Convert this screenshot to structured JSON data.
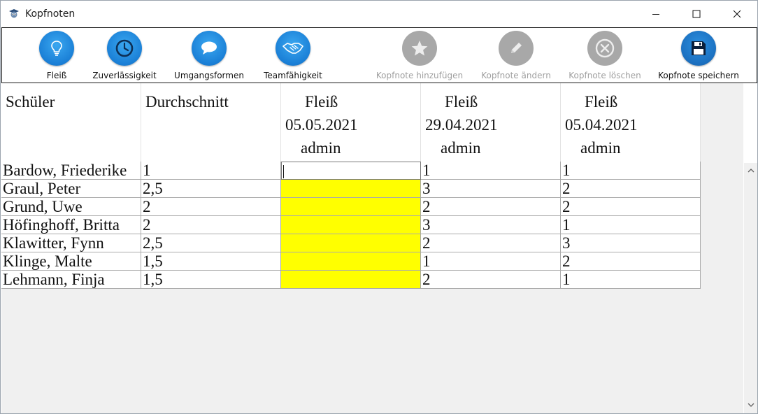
{
  "window": {
    "title": "Kopfnoten"
  },
  "toolbar": {
    "buttons": [
      {
        "label": "Fleiß",
        "icon": "lightbulb-icon",
        "enabled": true
      },
      {
        "label": "Zuverlässigkeit",
        "icon": "clock-icon",
        "enabled": true
      },
      {
        "label": "Umgangsformen",
        "icon": "speech-bubble-icon",
        "enabled": true
      },
      {
        "label": "Teamfähigkeit",
        "icon": "handshake-icon",
        "enabled": true
      },
      {
        "label": "Kopfnote hinzufügen",
        "icon": "star-icon",
        "enabled": false
      },
      {
        "label": "Kopfnote ändern",
        "icon": "pencil-icon",
        "enabled": false
      },
      {
        "label": "Kopfnote löschen",
        "icon": "delete-circle-icon",
        "enabled": false
      },
      {
        "label": "Kopfnote speichern",
        "icon": "floppy-disk-icon",
        "enabled": true
      }
    ]
  },
  "grid": {
    "columns": [
      {
        "lines": [
          "Schüler"
        ]
      },
      {
        "lines": [
          "Durchschnitt"
        ]
      },
      {
        "lines": [
          "Fleiß",
          "05.05.2021",
          "admin"
        ]
      },
      {
        "lines": [
          "Fleiß",
          "29.04.2021",
          "admin"
        ]
      },
      {
        "lines": [
          "Fleiß",
          "05.04.2021",
          "admin"
        ]
      }
    ],
    "rows": [
      [
        "Bardow, Friederike",
        "1",
        "",
        "1",
        "1"
      ],
      [
        "Graul, Peter",
        "2,5",
        "",
        "3",
        "2"
      ],
      [
        "Grund, Uwe",
        "2",
        "",
        "2",
        "2"
      ],
      [
        "Höfinghoff, Britta",
        "2",
        "",
        "3",
        "1"
      ],
      [
        "Klawitter, Fynn",
        "2,5",
        "",
        "2",
        "3"
      ],
      [
        "Klinge, Malte",
        "1,5",
        "",
        "1",
        "2"
      ],
      [
        "Lehmann, Finja",
        "1,5",
        "",
        "2",
        "1"
      ]
    ],
    "highlight_color": "#ffff00",
    "editing_cell": {
      "row": 0,
      "column": 2
    }
  },
  "colors": {
    "accent": "#1a7fd6",
    "disabled": "#a8a8a8",
    "highlight": "#ffff00"
  }
}
